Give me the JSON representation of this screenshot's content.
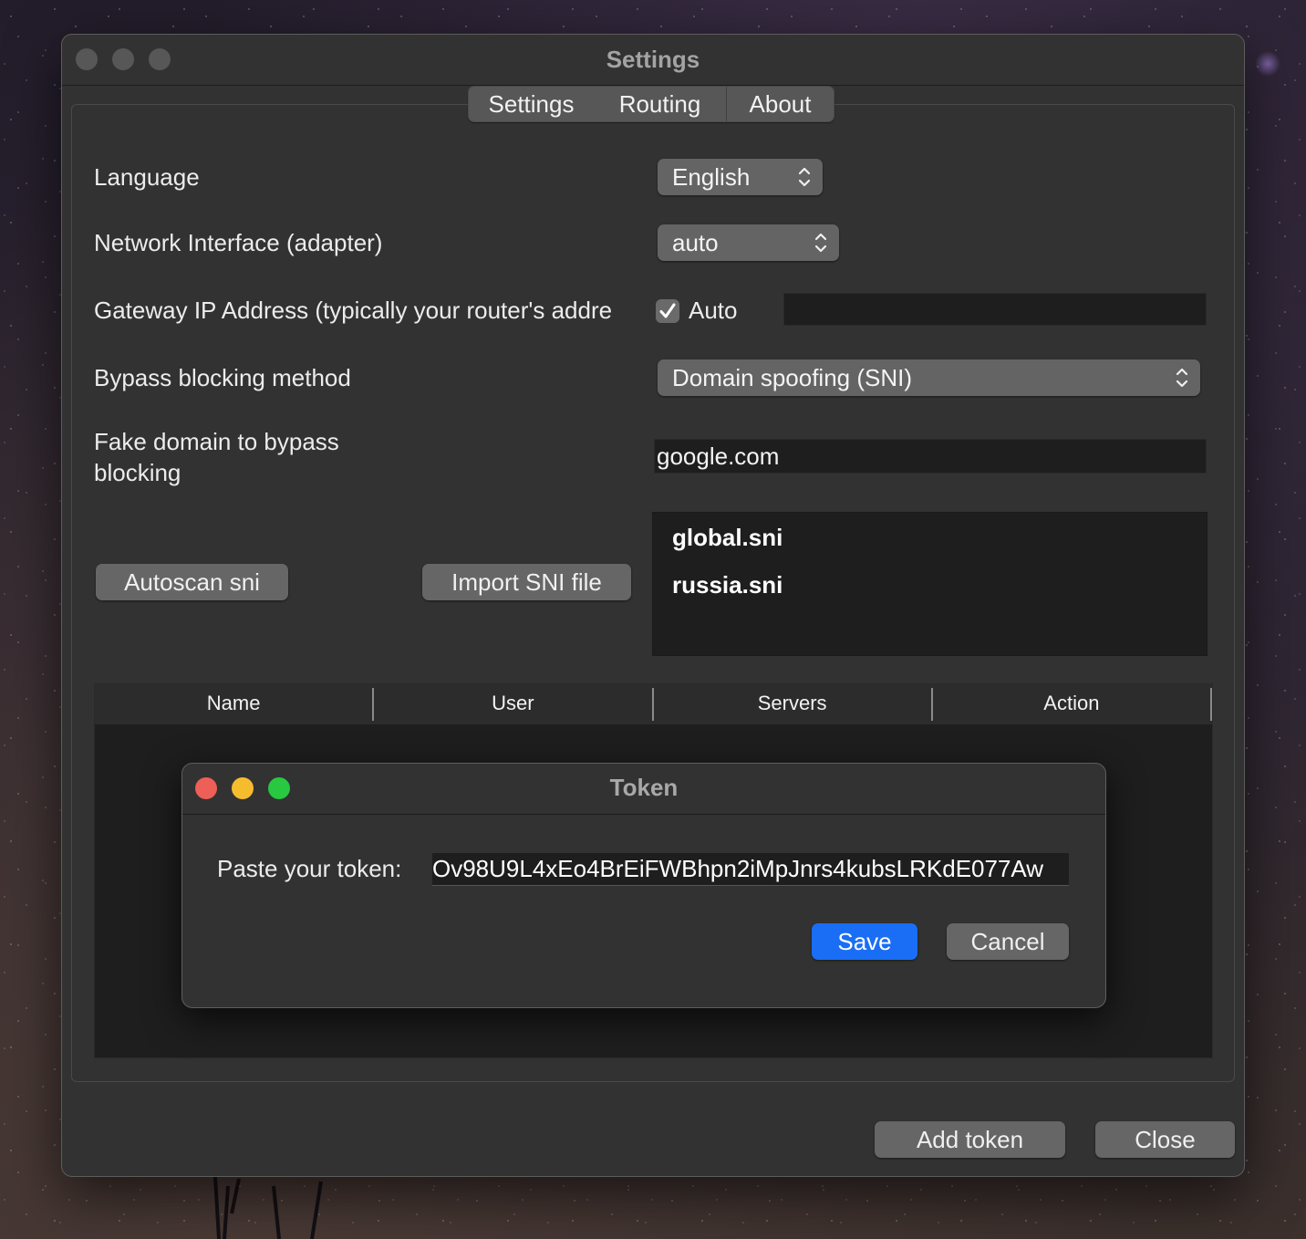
{
  "window": {
    "title": "Settings",
    "tabs": [
      {
        "label": "Settings"
      },
      {
        "label": "Routing"
      },
      {
        "label": "About"
      }
    ]
  },
  "settings": {
    "language": {
      "label": "Language",
      "value": "English"
    },
    "network_interface": {
      "label": "Network Interface (adapter)",
      "value": "auto"
    },
    "gateway": {
      "label": "Gateway IP Address (typically your router's addre",
      "auto_label": "Auto",
      "auto_checked": true,
      "value": ""
    },
    "bypass_method": {
      "label": "Bypass blocking method",
      "value": "Domain spoofing (SNI)"
    },
    "fake_domain": {
      "label_line1": "Fake domain to bypass",
      "label_line2": "blocking",
      "value": "google.com"
    },
    "autoscan_button": "Autoscan sni",
    "import_button": "Import SNI file",
    "sni_files": [
      "global.sni",
      "russia.sni"
    ]
  },
  "tokens_table": {
    "columns": [
      "Name",
      "User",
      "Servers",
      "Action"
    ],
    "rows": []
  },
  "token_dialog": {
    "title": "Token",
    "label": "Paste your token:",
    "value": "Ov98U9L4xEo4BrEiFWBhpn2iMpJnrs4kubsLRKdE077Aw",
    "save": "Save",
    "cancel": "Cancel"
  },
  "footer": {
    "add_token": "Add token",
    "close": "Close"
  },
  "colors": {
    "accent": "#1a6ef5",
    "close_red": "#ed5f57",
    "minimize_yellow": "#f5bd2e",
    "zoom_green": "#28c840"
  },
  "icons": {
    "popup_arrows": "up-down-chevron-icon",
    "checkbox": "checkmark-icon"
  }
}
